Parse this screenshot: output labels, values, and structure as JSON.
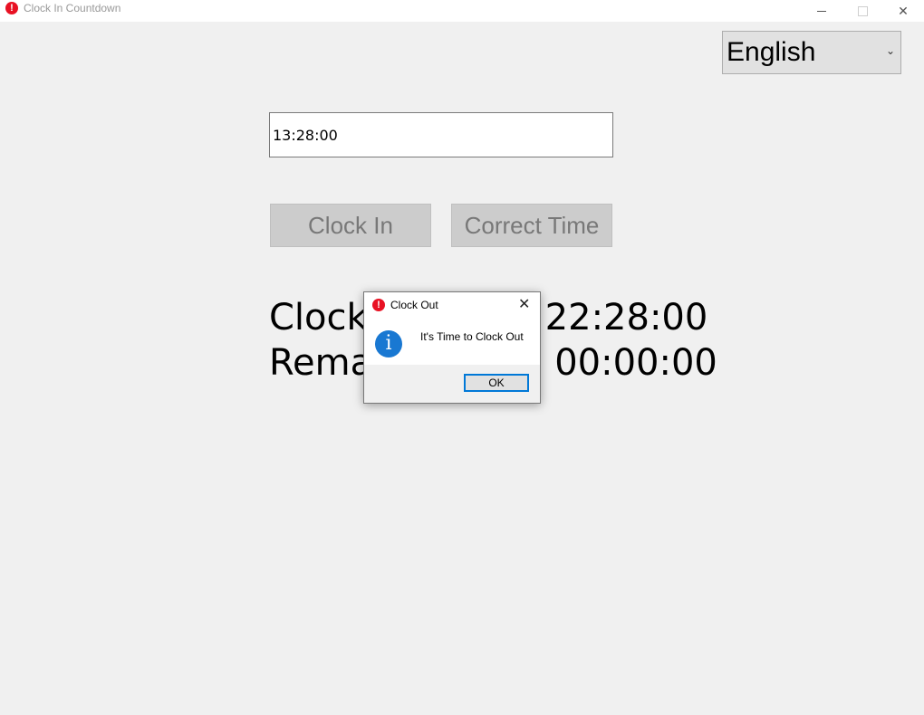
{
  "window": {
    "title": "Clock In Countdown"
  },
  "language": {
    "selected": "English"
  },
  "time_input": {
    "value": "13:28:00"
  },
  "buttons": {
    "clock_in": "Clock In",
    "correct_time": "Correct Time"
  },
  "info": {
    "line1_label": "Clock",
    "line1_value": "22:28:00",
    "line2_label": "Remai",
    "line2_value": "00:00:00"
  },
  "dialog": {
    "title": "Clock Out",
    "message": "It's Time to Clock Out",
    "ok_label": "OK"
  }
}
